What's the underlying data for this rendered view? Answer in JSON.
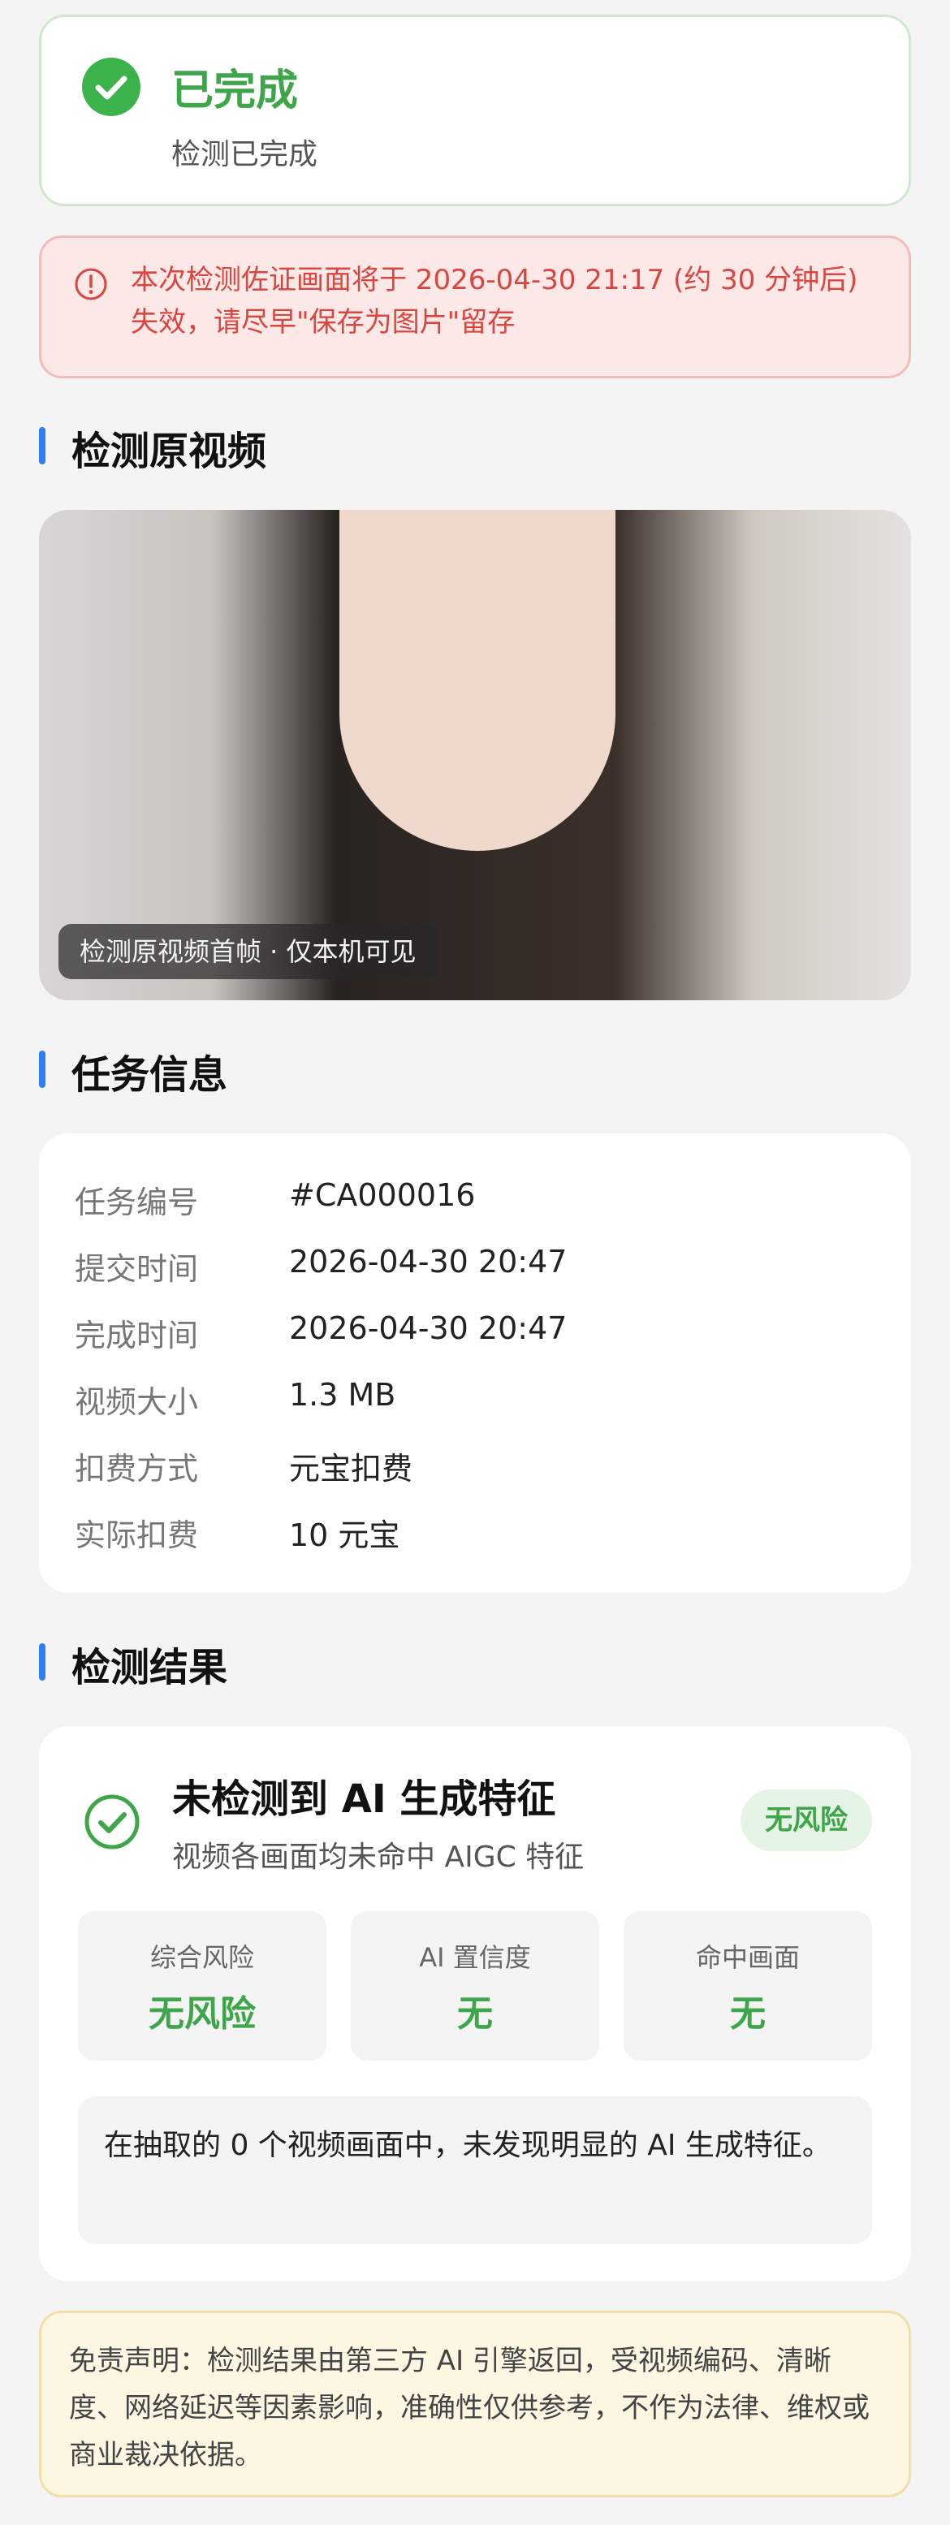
{
  "status": {
    "title": "已完成",
    "subtitle": "检测已完成"
  },
  "warning": {
    "text": "本次检测佐证画面将于 2026-04-30 21:17 (约 30 分钟后) 失效，请尽早\"保存为图片\"留存"
  },
  "sections": {
    "video": "检测原视频",
    "task": "任务信息",
    "result": "检测结果"
  },
  "video": {
    "caption": "检测原视频首帧 · 仅本机可见"
  },
  "task_info": {
    "rows": [
      {
        "label": "任务编号",
        "value": "#CA000016"
      },
      {
        "label": "提交时间",
        "value": "2026-04-30 20:47"
      },
      {
        "label": "完成时间",
        "value": "2026-04-30 20:47"
      },
      {
        "label": "视频大小",
        "value": "1.3 MB"
      },
      {
        "label": "扣费方式",
        "value": "元宝扣费"
      },
      {
        "label": "实际扣费",
        "value": "10 元宝"
      }
    ]
  },
  "result": {
    "title": "未检测到 AI 生成特征",
    "subtitle": "视频各画面均未命中 AIGC 特征",
    "badge": "无风险",
    "stats": [
      {
        "label": "综合风险",
        "value": "无风险"
      },
      {
        "label": "AI 置信度",
        "value": "无"
      },
      {
        "label": "命中画面",
        "value": "无"
      }
    ],
    "summary": "在抽取的 0 个视频画面中，未发现明显的 AI 生成特征。"
  },
  "disclaimer": {
    "text": "免责声明：检测结果由第三方 AI 引擎返回，受视频编码、清晰度、网络延迟等因素影响，准确性仅供参考，不作为法律、维权或商业裁决依据。"
  },
  "colors": {
    "success": "#3ea54a",
    "accent": "#2f7ef5",
    "danger": "#d9463f"
  }
}
